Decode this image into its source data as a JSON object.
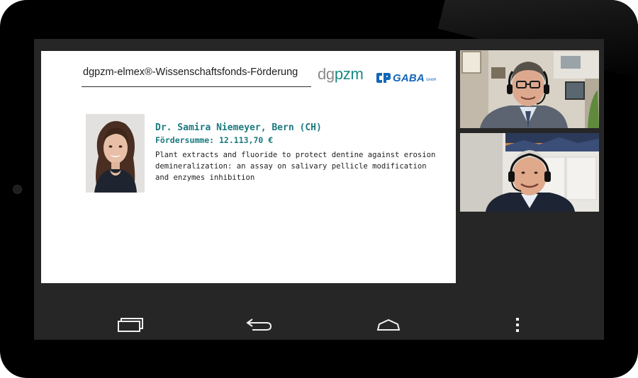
{
  "slide": {
    "title": "dgpzm-elmex®-Wissenschaftsfonds-Förderung",
    "logo_dgpzm": {
      "dg": "dg",
      "pzm": "pzm"
    },
    "logo_gaba": {
      "name": "GABA",
      "suffix": "GmbH",
      "color": "#1466b8"
    },
    "awardee": {
      "name": "Dr. Samira Niemeyer, Bern (CH)",
      "funding": "Fördersumme: 12.113,70 €",
      "description": "Plant extracts and fluoride to protect dentine against erosion demineralization: an assay on salivary pellicle modification and enzymes inhibition"
    },
    "accent_color": "#1b7a7f"
  },
  "participants": [
    {
      "icon": "participant-video-1"
    },
    {
      "icon": "participant-video-2"
    }
  ],
  "navbar": {
    "buttons": [
      {
        "icon": "recent-apps-icon"
      },
      {
        "icon": "back-icon"
      },
      {
        "icon": "home-icon"
      },
      {
        "icon": "menu-icon"
      }
    ]
  }
}
